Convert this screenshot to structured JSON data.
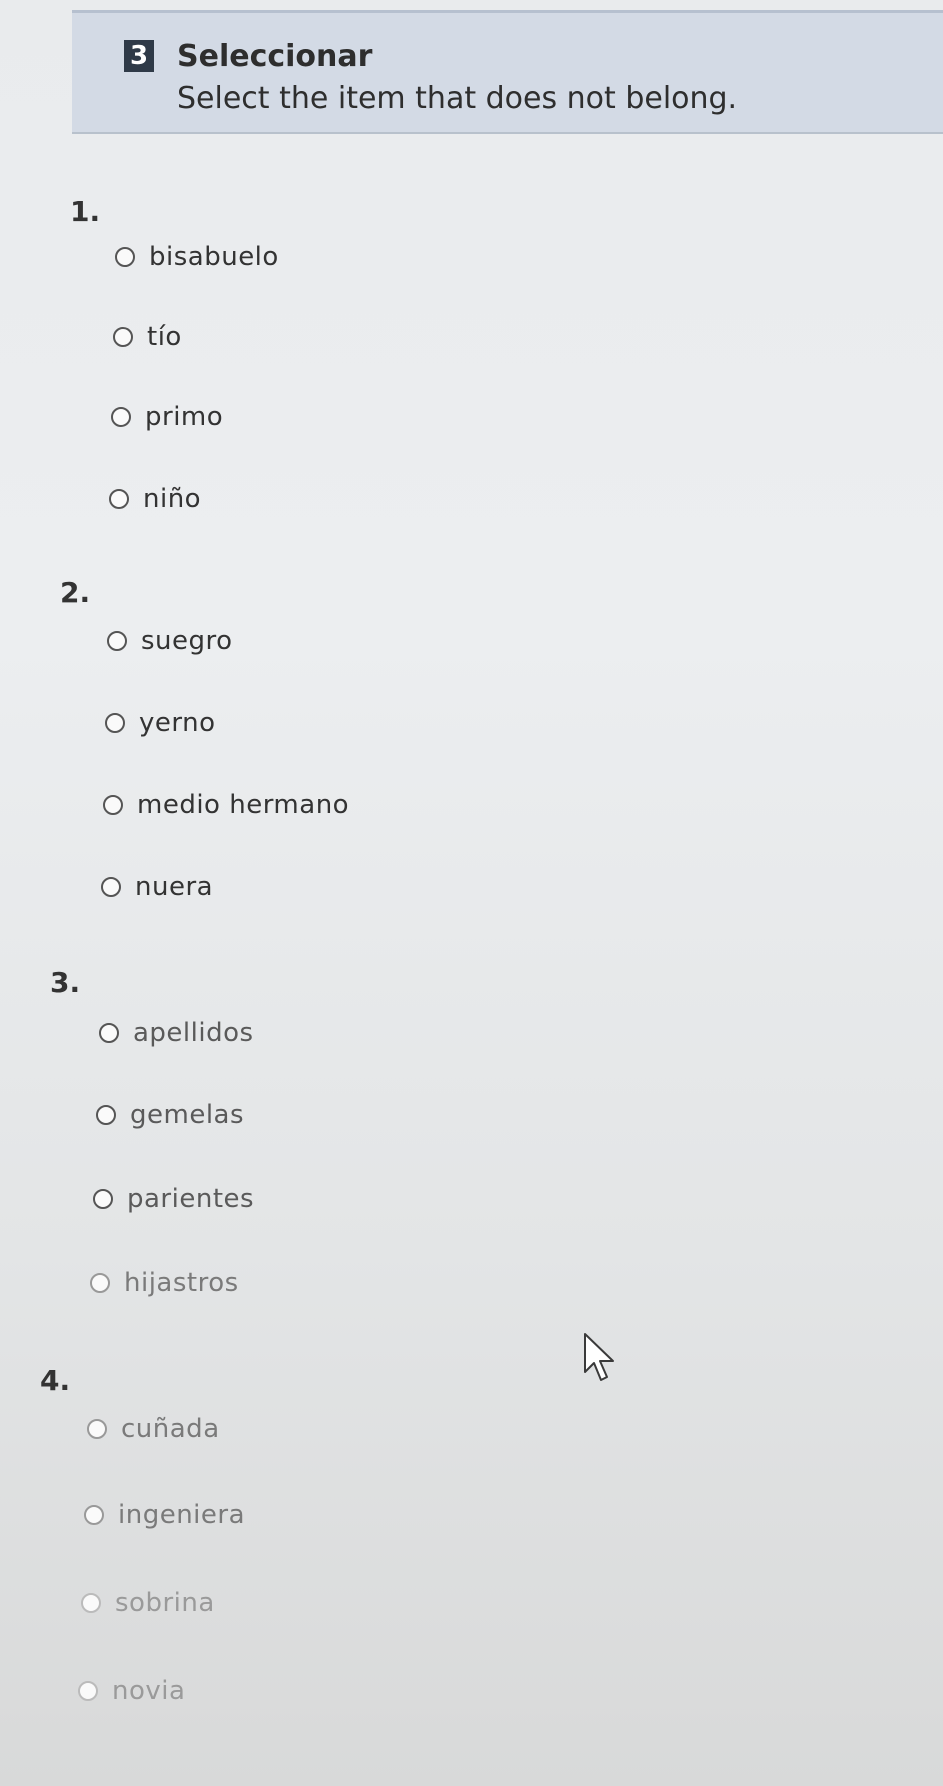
{
  "section": {
    "number": "3",
    "title": "Seleccionar",
    "instruction": "Select the item that does not belong."
  },
  "questions": [
    {
      "number": "1.",
      "options": [
        "bisabuelo",
        "tío",
        "primo",
        "niño"
      ]
    },
    {
      "number": "2.",
      "options": [
        "suegro",
        "yerno",
        "medio hermano",
        "nuera"
      ]
    },
    {
      "number": "3.",
      "options": [
        "apellidos",
        "gemelas",
        "parientes",
        "hijastros"
      ]
    },
    {
      "number": "4.",
      "options": [
        "cuñada",
        "ingeniera",
        "sobrina",
        "novia"
      ]
    }
  ],
  "icons": {
    "cursor": "mouse-pointer-icon",
    "option": "radio-button-icon"
  }
}
